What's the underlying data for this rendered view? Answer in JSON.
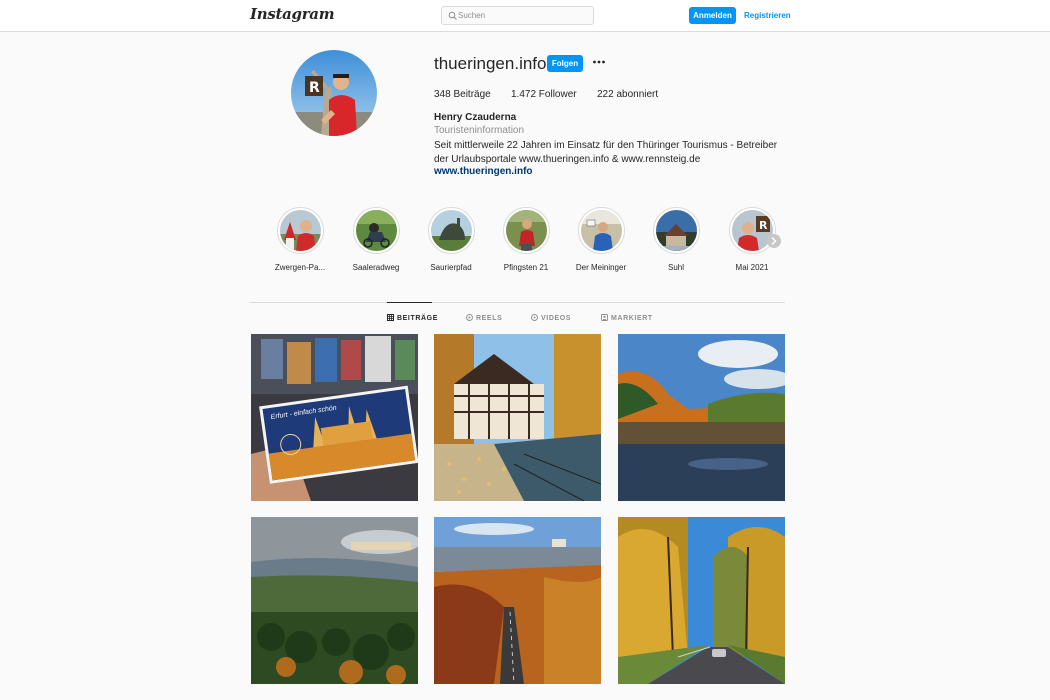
{
  "header": {
    "logo": "Instagram",
    "search_placeholder": "Suchen",
    "login_label": "Anmelden",
    "register_label": "Registrieren"
  },
  "profile": {
    "username": "thueringen.info",
    "follow_label": "Folgen",
    "stats": {
      "posts": "348 Beiträge",
      "followers": "1.472 Follower",
      "following": "222 abonniert"
    },
    "full_name": "Henry Czauderna",
    "category": "Touristeninformation",
    "bio": "Seit mittlerweile 22 Jahren im Einsatz für den Thüringer Tourismus - Betreiber der Urlaubsportale www.thueringen.info & www.rennsteig.de",
    "website": "www.thueringen.info"
  },
  "highlights": [
    {
      "label": "Zwergen-Pa..."
    },
    {
      "label": "Saaleradweg"
    },
    {
      "label": "Saurierpfad"
    },
    {
      "label": "Pfingsten 21"
    },
    {
      "label": "Der Meininger"
    },
    {
      "label": "Suhl"
    },
    {
      "label": "Mai 2021"
    }
  ],
  "tabs": [
    {
      "label": "BEITRÄGE",
      "icon": "grid-icon"
    },
    {
      "label": "REELS",
      "icon": "reels-icon"
    },
    {
      "label": "VIDEOS",
      "icon": "video-icon"
    },
    {
      "label": "MARKIERT",
      "icon": "tagged-icon"
    }
  ],
  "posts": {
    "postcard_text": "Erfurt - einfach schön"
  },
  "colors": {
    "accent": "#0095f6",
    "link": "#00376b",
    "border": "#dbdbdb",
    "background": "#fafafa",
    "muted": "#8e8e8e"
  }
}
